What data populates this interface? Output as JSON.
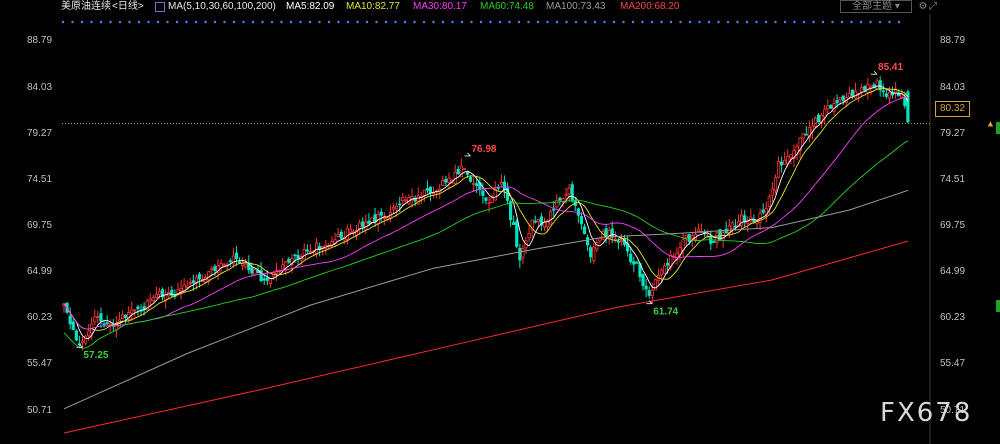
{
  "header": {
    "instrument": "美原油连续",
    "period": "<日线>",
    "ma_label": "MA(5,10,30,60,100,200)",
    "ma5": "MA5:82.09",
    "ma10": "MA10:82.77",
    "ma30": "MA30:80.17",
    "ma60": "MA60:74.48",
    "ma100": "MA100:73.43",
    "ma200": "MA200:68.20",
    "dropdown": "全部主题"
  },
  "colors": {
    "ma5": "#ffffff",
    "ma10": "#e6e62d",
    "ma30": "#ff3cff",
    "ma60": "#22d322",
    "ma100": "#9a9a9a",
    "ma200": "#ff2a2a",
    "up": "#ff3333",
    "down": "#00e5c0",
    "price_line": "#d9a43a"
  },
  "icons": {
    "settings": "gear-icon",
    "expand": "expand-icon"
  },
  "current_price": "80.32",
  "watermark": "FX678",
  "chart_data": {
    "type": "candlestick",
    "y_ticks": [
      "88.79",
      "84.03",
      "79.27",
      "74.51",
      "69.75",
      "64.99",
      "60.23",
      "55.47",
      "50.71"
    ],
    "ylim": [
      48.3,
      91.2
    ],
    "grid": false,
    "annotations": [
      {
        "label": "57.25",
        "x": 5,
        "y": 57.25,
        "type": "low"
      },
      {
        "label": "76.98",
        "x": 131,
        "y": 76.98,
        "type": "high"
      },
      {
        "label": "61.74",
        "x": 190,
        "y": 61.74,
        "type": "low"
      },
      {
        "label": "85.41",
        "x": 263,
        "y": 85.41,
        "type": "high"
      }
    ],
    "current_price": 80.32,
    "waypoints": [
      [
        0,
        61.5
      ],
      [
        5,
        57.5
      ],
      [
        10,
        60.5
      ],
      [
        15,
        59.5
      ],
      [
        20,
        60.5
      ],
      [
        25,
        61.0
      ],
      [
        30,
        63.0
      ],
      [
        35,
        62.5
      ],
      [
        40,
        64.0
      ],
      [
        45,
        64.5
      ],
      [
        50,
        65.5
      ],
      [
        55,
        66.5
      ],
      [
        60,
        65.5
      ],
      [
        65,
        64.0
      ],
      [
        70,
        65.5
      ],
      [
        75,
        66.5
      ],
      [
        80,
        67.5
      ],
      [
        85,
        67.8
      ],
      [
        90,
        68.8
      ],
      [
        95,
        69.5
      ],
      [
        100,
        70.2
      ],
      [
        105,
        71.0
      ],
      [
        110,
        72.3
      ],
      [
        115,
        72.8
      ],
      [
        120,
        73.5
      ],
      [
        125,
        74.5
      ],
      [
        130,
        75.8
      ],
      [
        133,
        74.2
      ],
      [
        137,
        72.0
      ],
      [
        142,
        74.5
      ],
      [
        146,
        69.5
      ],
      [
        148,
        66.0
      ],
      [
        152,
        70.5
      ],
      [
        156,
        70.0
      ],
      [
        160,
        72.0
      ],
      [
        164,
        73.5
      ],
      [
        168,
        70.0
      ],
      [
        171,
        66.5
      ],
      [
        174,
        68.5
      ],
      [
        177,
        69.2
      ],
      [
        182,
        67.5
      ],
      [
        186,
        65.5
      ],
      [
        190,
        62.5
      ],
      [
        193,
        65.0
      ],
      [
        197,
        66.5
      ],
      [
        201,
        68.2
      ],
      [
        206,
        69.0
      ],
      [
        210,
        68.2
      ],
      [
        215,
        69.2
      ],
      [
        220,
        70.5
      ],
      [
        224,
        70.2
      ],
      [
        228,
        72.0
      ],
      [
        232,
        76.0
      ],
      [
        236,
        77.0
      ],
      [
        240,
        79.0
      ],
      [
        244,
        80.5
      ],
      [
        249,
        82.2
      ],
      [
        253,
        83.0
      ],
      [
        257,
        83.6
      ],
      [
        261,
        84.0
      ],
      [
        264,
        84.5
      ],
      [
        267,
        83.2
      ],
      [
        270,
        83.5
      ],
      [
        272,
        83.6
      ],
      [
        274,
        80.5
      ]
    ],
    "moving_averages": [
      {
        "name": "MA5",
        "period": 5,
        "color": "#ffffff",
        "current": 82.09
      },
      {
        "name": "MA10",
        "period": 10,
        "color": "#e6e62d",
        "current": 82.77
      },
      {
        "name": "MA30",
        "period": 30,
        "color": "#ff3cff",
        "current": 80.17
      },
      {
        "name": "MA60",
        "period": 60,
        "color": "#22d322",
        "current": 74.48
      },
      {
        "name": "MA100",
        "period": 100,
        "color": "#9a9a9a",
        "current": 73.43
      },
      {
        "name": "MA200",
        "period": 200,
        "color": "#ff2a2a",
        "current": 68.2
      }
    ],
    "long_ma_paths": [
      {
        "name": "MA100",
        "points": [
          [
            0,
            50.9
          ],
          [
            40,
            56.6
          ],
          [
            80,
            61.6
          ],
          [
            120,
            65.4
          ],
          [
            150,
            67.2
          ],
          [
            175,
            68.6
          ],
          [
            200,
            69.0
          ],
          [
            230,
            69.6
          ],
          [
            255,
            71.4
          ],
          [
            274,
            73.43
          ]
        ]
      },
      {
        "name": "MA200",
        "points": [
          [
            0,
            48.4
          ],
          [
            60,
            52.6
          ],
          [
            120,
            57.0
          ],
          [
            180,
            61.4
          ],
          [
            230,
            64.2
          ],
          [
            274,
            68.2
          ]
        ]
      }
    ]
  }
}
